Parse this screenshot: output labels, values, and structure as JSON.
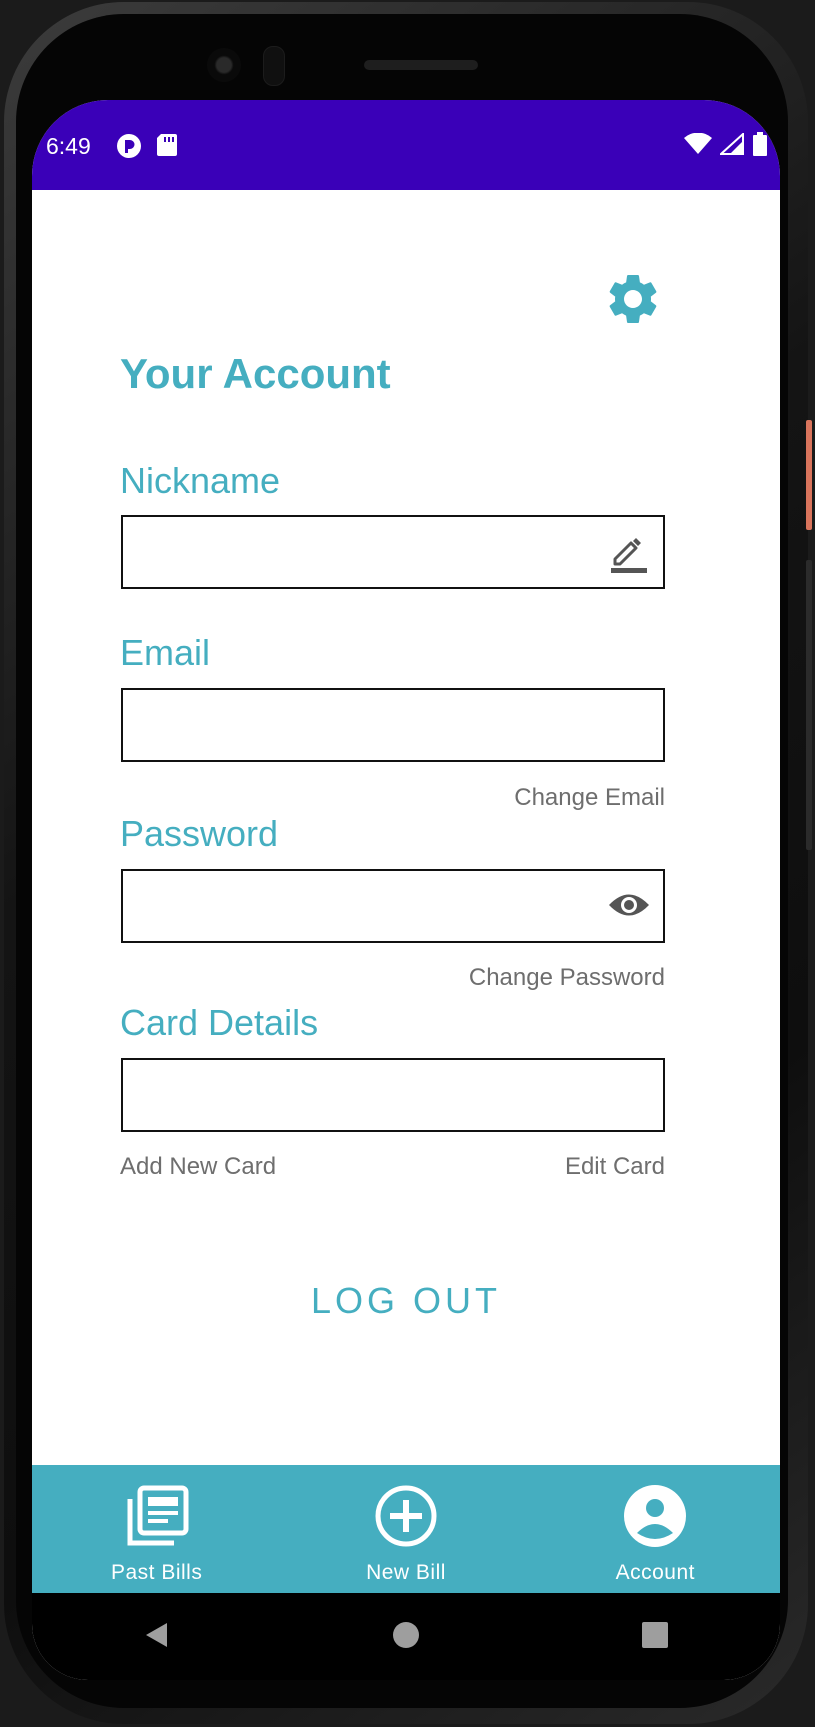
{
  "status_bar": {
    "time": "6:49",
    "left_icons": [
      "notification-app-icon",
      "sd-card-icon"
    ],
    "right_icons": [
      "wifi-icon",
      "cell-signal-icon",
      "battery-icon"
    ],
    "color": "#3a00b8"
  },
  "header": {
    "settings_icon": "gear-icon",
    "title": "Your Account"
  },
  "form": {
    "nickname": {
      "label": "Nickname",
      "value": "",
      "icon": "edit-pencil-icon"
    },
    "email": {
      "label": "Email",
      "value": "",
      "action": "Change Email"
    },
    "password": {
      "label": "Password",
      "value": "",
      "icon": "eye-icon",
      "action": "Change Password"
    },
    "card": {
      "label": "Card Details",
      "value": "",
      "add_action": "Add New Card",
      "edit_action": "Edit Card"
    }
  },
  "logout_label": "LOG OUT",
  "bottom_nav": {
    "items": [
      {
        "label": "Past Bills",
        "icon": "bills-stack-icon"
      },
      {
        "label": "New Bill",
        "icon": "plus-circle-icon"
      },
      {
        "label": "Account",
        "icon": "account-circle-icon",
        "selected": true
      }
    ],
    "color": "#45aec0"
  },
  "system_nav": {
    "buttons": [
      "back-triangle-icon",
      "home-circle-icon",
      "recents-square-icon"
    ]
  },
  "accent_color": "#45aec0"
}
